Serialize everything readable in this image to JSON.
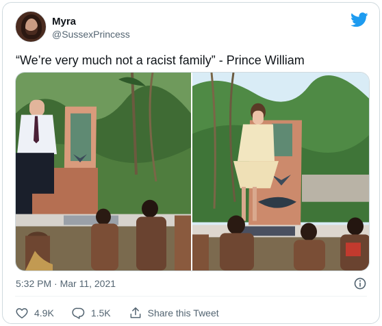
{
  "tweet": {
    "author_name": "Myra",
    "author_handle": "@SussexPrincess",
    "text": "“We’re very much not a racist family” - Prince William",
    "timestamp": "5:32 PM · Mar 11, 2021"
  },
  "actions": {
    "likes_count": "4.9K",
    "replies_count": "1.5K",
    "share_label": "Share this Tweet"
  },
  "colors": {
    "brand_blue": "#1d9bf0",
    "secondary_text": "#536471",
    "border": "#cfd9de"
  },
  "icons": {
    "brand": "twitter-bird-icon",
    "info": "info-icon",
    "like": "heart-icon",
    "reply": "reply-icon",
    "share": "share-icon"
  }
}
